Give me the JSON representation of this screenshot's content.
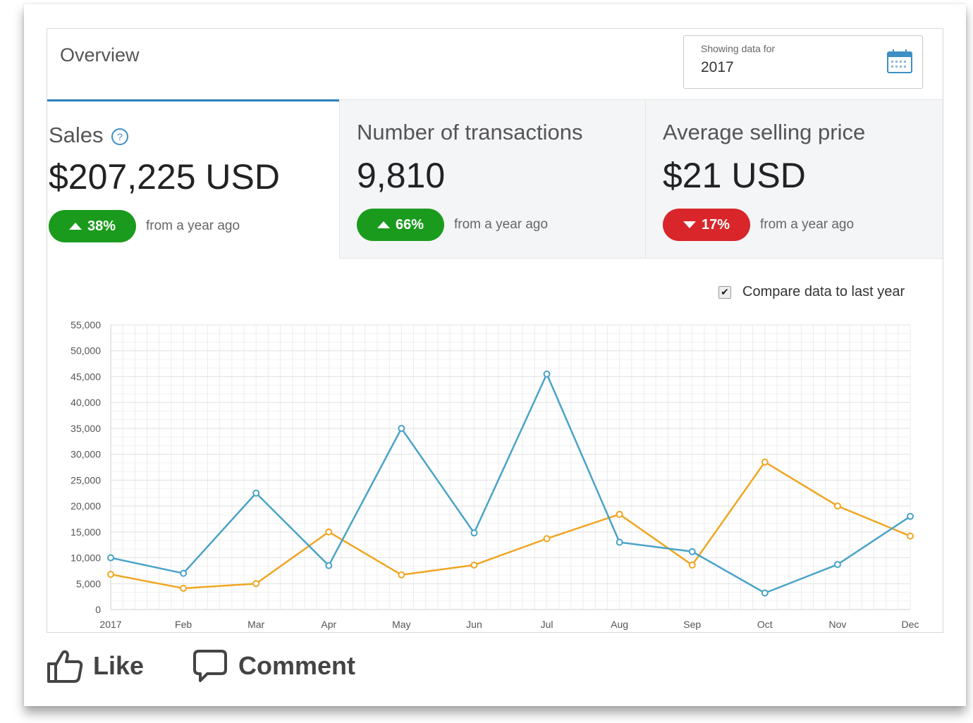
{
  "header": {
    "title": "Overview",
    "date_picker": {
      "label": "Showing data for",
      "value": "2017",
      "icon": "calendar-icon"
    }
  },
  "metrics": [
    {
      "title": "Sales",
      "value": "$207,225 USD",
      "change": "38%",
      "direction": "up",
      "comparison": "from a year ago",
      "has_help": true
    },
    {
      "title": "Number of transactions",
      "value": "9,810",
      "change": "66%",
      "direction": "up",
      "comparison": "from a year ago"
    },
    {
      "title": "Average selling price",
      "value": "$21 USD",
      "change": "17%",
      "direction": "down",
      "comparison": "from a year ago"
    }
  ],
  "compare": {
    "label": "Compare data to last year",
    "checked": true
  },
  "colors": {
    "accent": "#2e7fb8",
    "up": "#1b9b1e",
    "down": "#d8262a",
    "series_current": "#4aa3c8",
    "series_previous": "#f0a623"
  },
  "chart_data": {
    "type": "line",
    "categories": [
      "2017",
      "Feb",
      "Mar",
      "Apr",
      "May",
      "Jun",
      "Jul",
      "Aug",
      "Sep",
      "Oct",
      "Nov",
      "Dec"
    ],
    "series": [
      {
        "values": [
          10000,
          7000,
          22500,
          8500,
          35000,
          14800,
          45500,
          13000,
          11200,
          3200,
          8700,
          18000
        ],
        "color": "#4aa3c8"
      },
      {
        "values": [
          6800,
          4100,
          5000,
          15000,
          6700,
          8600,
          13700,
          18400,
          8600,
          28500,
          20000,
          14200
        ],
        "color": "#f0a623"
      }
    ],
    "yticks": [
      "0",
      "5,000",
      "10,000",
      "15,000",
      "20,000",
      "25,000",
      "30,000",
      "35,000",
      "40,000",
      "45,000",
      "50,000",
      "55,000"
    ],
    "ylim": [
      0,
      55000
    ],
    "grid": true
  },
  "actions": {
    "like_label": "Like",
    "comment_label": "Comment"
  }
}
